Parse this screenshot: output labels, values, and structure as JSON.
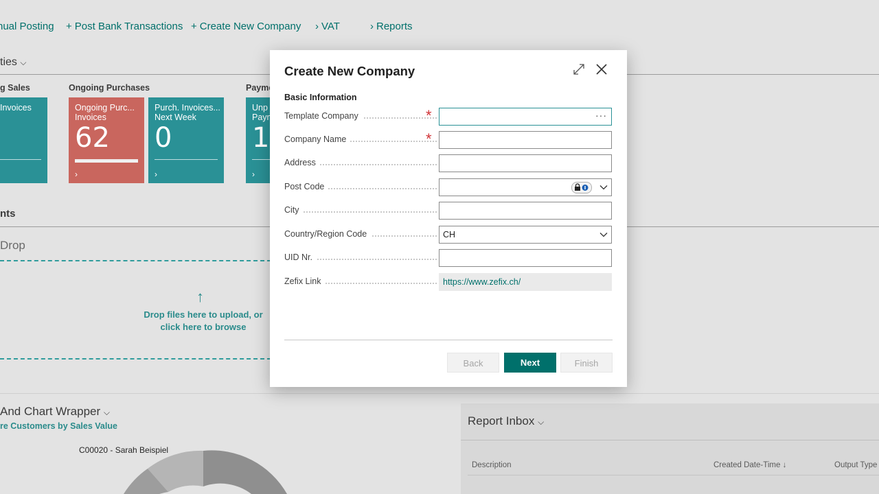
{
  "background": {
    "actions": [
      {
        "glyph": "",
        "label": "nual Posting"
      },
      {
        "glyph": "+",
        "label": "Post Bank Transactions"
      },
      {
        "glyph": "+",
        "label": "Create New Company"
      },
      {
        "glyph": "›",
        "label": "VAT"
      },
      {
        "glyph": "›",
        "label": "Reports"
      }
    ],
    "activities_title": "ties",
    "groups": [
      "g Sales",
      "Ongoing Purchases",
      "Payme"
    ],
    "tiles": [
      {
        "label": "Invoices",
        "value": "",
        "color": "#2a9196"
      },
      {
        "label": "Ongoing Purc...\nInvoices",
        "value": "62",
        "color": "#c9665e"
      },
      {
        "label": "Purch. Invoices...\nNext Week",
        "value": "0",
        "color": "#2a9196"
      },
      {
        "label": "Unp\nPaym",
        "value": "1",
        "color": "#2a9196"
      }
    ],
    "attachments_title": "nts",
    "drop_title": "Drop",
    "drop_text": "Drop files here to upload, or click here to browse",
    "chart_wrapper_title": "And Chart Wrapper",
    "chart_subtitle": "re Customers by Sales Value",
    "chart_label": "C00020 - Sarah Beispiel",
    "report_inbox": {
      "title": "Report Inbox",
      "columns": [
        "Description",
        "Created Date-Time",
        "Output Type"
      ]
    }
  },
  "dialog": {
    "title": "Create New Company",
    "group": "Basic Information",
    "fields": [
      {
        "label": "Template Company",
        "value": "",
        "required": true
      },
      {
        "label": "Company Name",
        "value": "",
        "required": true
      },
      {
        "label": "Address",
        "value": ""
      },
      {
        "label": "Post Code",
        "value": ""
      },
      {
        "label": "City",
        "value": ""
      },
      {
        "label": "Country/Region Code",
        "value": "CH"
      },
      {
        "label": "UID Nr.",
        "value": ""
      },
      {
        "label": "Zefix Link",
        "value": "https://www.zefix.ch/"
      }
    ],
    "buttons": {
      "back": "Back",
      "next": "Next",
      "finish": "Finish"
    }
  }
}
